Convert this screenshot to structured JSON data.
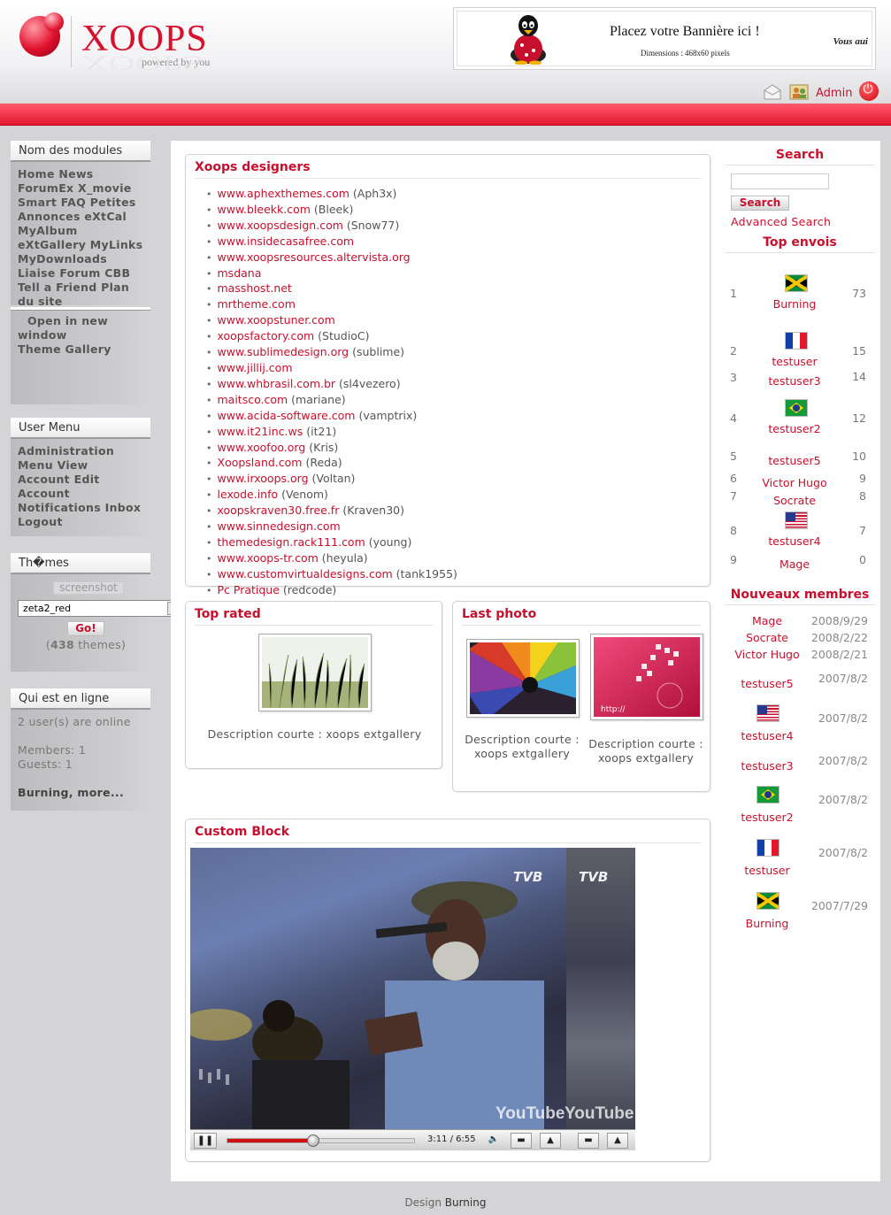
{
  "header": {
    "logo_text": "XOOPS",
    "logo_tagline": "powered by you",
    "banner_title": "Placez votre Bannière ici !",
    "banner_dims": "Dimensions : 468x60 pixels",
    "banner_side": "Vous aui",
    "admin_label": "Admin"
  },
  "left": {
    "modules_title": "Nom des modules",
    "modules_items": "Home News ForumEx X_movie Smart FAQ Petites Annonces eXtCal MyAlbum eXtGallery MyLinks MyDownloads Liaise Forum CBB Tell a Friend Plan du site",
    "gallery_open": "Open in new",
    "gallery_window": "window",
    "gallery_link": "Theme Gallery",
    "user_menu_title": "User Menu",
    "user_menu_items": "Administration Menu View Account Edit Account Notifications Inbox Logout",
    "themes_title": "Th�mes",
    "themes_screenshot": "screenshot",
    "themes_selected": "zeta2_red",
    "themes_go": "Go!",
    "themes_count_open": "(",
    "themes_count": "438",
    "themes_count_close": " themes)",
    "online_title": "Qui est en ligne",
    "online_users": "2 user(s) are online",
    "online_members": "Members: 1",
    "online_guests": "Guests: 1",
    "online_more": "Burning, more..."
  },
  "designers": {
    "title": "Xoops designers",
    "items": [
      {
        "url": "www.aphexthemes.com",
        "nick": " (Aph3x)"
      },
      {
        "url": "www.bleekk.com",
        "nick": " (Bleek)"
      },
      {
        "url": "www.xoopsdesign.com",
        "nick": " (Snow77)"
      },
      {
        "url": "www.insidecasafree.com",
        "nick": ""
      },
      {
        "url": "www.xoopsresources.altervista.org",
        "nick": ""
      },
      {
        "url": "msdana",
        "nick": ""
      },
      {
        "url": "masshost.net",
        "nick": ""
      },
      {
        "url": "mrtheme.com",
        "nick": ""
      },
      {
        "url": "www.xoopstuner.com",
        "nick": ""
      },
      {
        "url": "xoopsfactory.com",
        "nick": " (StudioC)"
      },
      {
        "url": "www.sublimedesign.org",
        "nick": " (sublime)"
      },
      {
        "url": "www.jillij.com",
        "nick": ""
      },
      {
        "url": "www.whbrasil.com.br",
        "nick": " (sl4vezero)"
      },
      {
        "url": "maitsco.com",
        "nick": " (mariane)"
      },
      {
        "url": "www.acida-software.com",
        "nick": " (vamptrix)"
      },
      {
        "url": "www.it21inc.ws",
        "nick": " (it21)"
      },
      {
        "url": "www.xoofoo.org",
        "nick": " (Kris)"
      },
      {
        "url": "Xoopsland.com",
        "nick": " (Reda)"
      },
      {
        "url": "www.irxoops.org",
        "nick": " (Voltan)"
      },
      {
        "url": "lexode.info",
        "nick": " (Venom)"
      },
      {
        "url": "xoopskraven30.free.fr",
        "nick": " (Kraven30)"
      },
      {
        "url": "www.sinnedesign.com",
        "nick": ""
      },
      {
        "url": "themedesign.rack111.com",
        "nick": " (young)"
      },
      {
        "url": "www.xoops-tr.com",
        "nick": " (heyula)"
      },
      {
        "url": "www.customvirtualdesigns.com",
        "nick": " (tank1955)"
      },
      {
        "url": "Pc Pratique",
        "nick": " (redcode)"
      }
    ]
  },
  "top_rated": {
    "title": "Top rated",
    "caption": "Description courte : xoops extgallery"
  },
  "last_photo": {
    "title": "Last photo",
    "caption1": "Description courte : xoops extgallery",
    "caption2": "Description courte : xoops extgallery",
    "watermark": "http://"
  },
  "custom_block": {
    "title": "Custom Block",
    "time": "3:11 / 6:55",
    "progress_fraction": 0.46,
    "yt1": "YouTube",
    "yt2": "YouTube",
    "tvb1": "TVB",
    "tvb2": "TVB"
  },
  "right": {
    "search_title": "Search",
    "search_button": "Search",
    "advanced_search": "Advanced Search",
    "top_title": "Top envois",
    "top": [
      {
        "rank": "1",
        "name": "Burning",
        "count": "73",
        "flag": "jm"
      },
      {
        "rank": "2",
        "name": "testuser",
        "count": "15",
        "flag": "fr"
      },
      {
        "rank": "3",
        "name": "testuser3",
        "count": "14",
        "flag": ""
      },
      {
        "rank": "4",
        "name": "testuser2",
        "count": "12",
        "flag": "br"
      },
      {
        "rank": "5",
        "name": "testuser5",
        "count": "10",
        "flag": ""
      },
      {
        "rank": "6",
        "name": "Victor Hugo",
        "count": "9",
        "flag": ""
      },
      {
        "rank": "7",
        "name": "Socrate",
        "count": "8",
        "flag": ""
      },
      {
        "rank": "8",
        "name": "testuser4",
        "count": "7",
        "flag": "us"
      },
      {
        "rank": "9",
        "name": "Mage",
        "count": "0",
        "flag": ""
      }
    ],
    "new_title": "Nouveaux membres",
    "members": [
      {
        "name": "Mage",
        "date": "2008/9/29",
        "flag": ""
      },
      {
        "name": "Socrate",
        "date": "2008/2/22",
        "flag": ""
      },
      {
        "name": "Victor Hugo",
        "date": "2008/2/21",
        "flag": ""
      },
      {
        "name": "testuser5",
        "date": "2007/8/2",
        "flag": ""
      },
      {
        "name": "testuser4",
        "date": "2007/8/2",
        "flag": "us"
      },
      {
        "name": "testuser3",
        "date": "2007/8/2",
        "flag": ""
      },
      {
        "name": "testuser2",
        "date": "2007/8/2",
        "flag": "br"
      },
      {
        "name": "testuser",
        "date": "2007/8/2",
        "flag": "fr"
      },
      {
        "name": "Burning",
        "date": "2007/7/29",
        "flag": "jm"
      }
    ]
  },
  "footer": {
    "design_label": "Design ",
    "design_author": "Burning"
  }
}
